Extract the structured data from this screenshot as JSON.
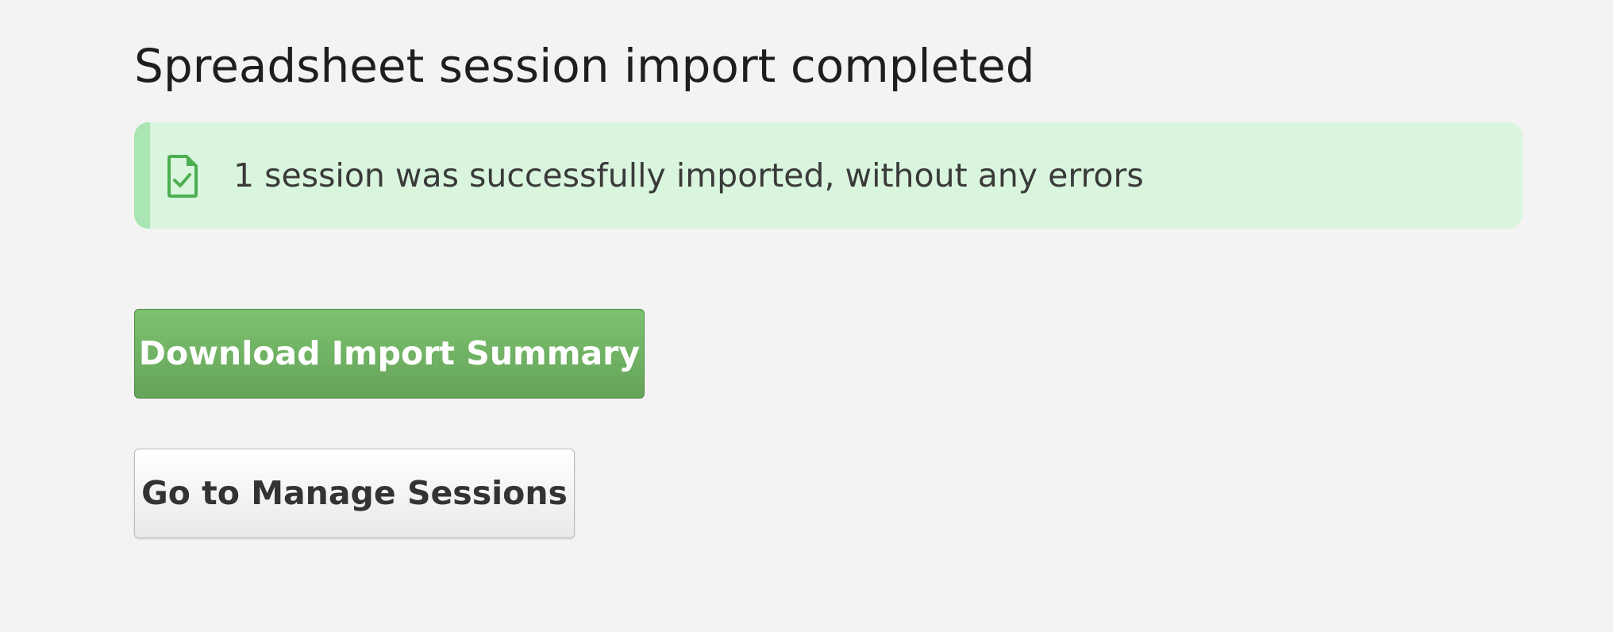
{
  "page": {
    "title": "Spreadsheet session import completed"
  },
  "alert": {
    "icon": "file-check-icon",
    "message": "1 session was successfully imported, without any errors",
    "colors": {
      "background": "#d9f5de",
      "accent": "#a9e6b3",
      "icon": "#4caf50"
    }
  },
  "actions": {
    "download_label": "Download Import Summary",
    "manage_label": "Go to Manage Sessions",
    "colors": {
      "primary": "#6fb363"
    }
  }
}
